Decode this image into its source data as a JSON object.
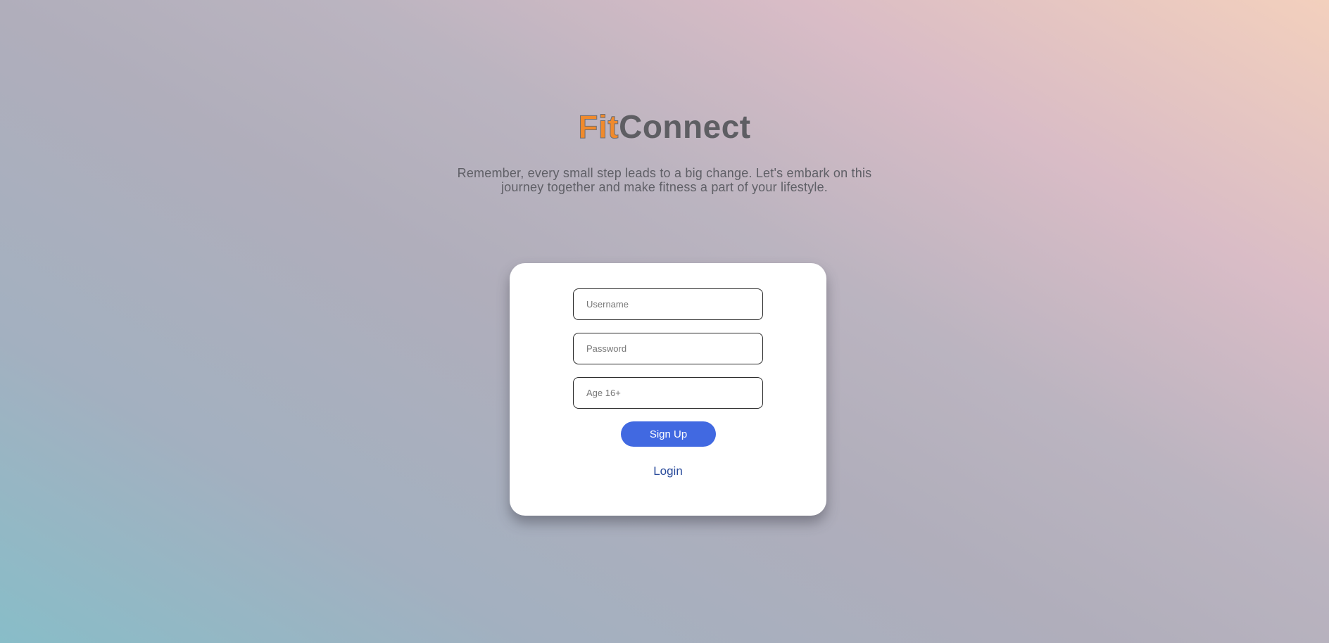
{
  "brand": {
    "part1": "Fit",
    "part2": "Connect"
  },
  "tagline": "Remember, every small step leads to a big change. Let's embark on this journey together and make fitness a part of your lifestyle.",
  "form": {
    "username_placeholder": "Username",
    "password_placeholder": "Password",
    "age_placeholder": "Age 16+",
    "signup_label": "Sign Up",
    "login_label": "Login"
  },
  "colors": {
    "accent": "#4169e1",
    "brand_fit": "#f08a2c",
    "brand_connect": "#5e5e63",
    "link": "#2a4b9b"
  }
}
